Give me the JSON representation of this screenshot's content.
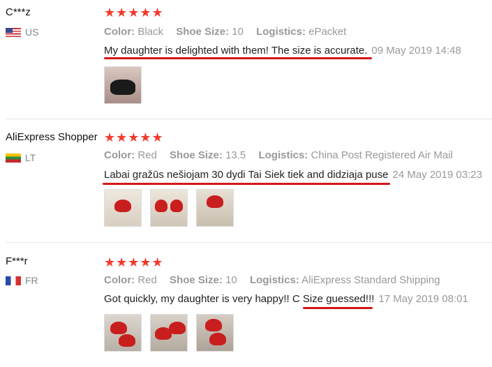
{
  "reviews": [
    {
      "user": "C***z",
      "country": "US",
      "rating_stars": 5,
      "stars_text": "★★★★★",
      "attributes": [
        {
          "label": "Color:",
          "value": "Black"
        },
        {
          "label": "Shoe Size:",
          "value": "10"
        },
        {
          "label": "Logistics:",
          "value": "ePacket"
        }
      ],
      "comment": "My daughter is delighted with them! The size is accurate.",
      "date": "09 May 2019 14:48"
    },
    {
      "user": "AliExpress Shopper",
      "country": "LT",
      "rating_stars": 5,
      "stars_text": "★★★★★",
      "attributes": [
        {
          "label": "Color:",
          "value": "Red"
        },
        {
          "label": "Shoe Size:",
          "value": "13.5"
        },
        {
          "label": "Logistics:",
          "value": "China Post Registered Air Mail"
        }
      ],
      "comment": "Labai gražūs nešiojam 30 dydi Tai Siek tiek and didziaja puse",
      "date": "24 May 2019 03:23"
    },
    {
      "user": "F***r",
      "country": "FR",
      "rating_stars": 5,
      "stars_text": "★★★★★",
      "attributes": [
        {
          "label": "Color:",
          "value": "Red"
        },
        {
          "label": "Shoe Size:",
          "value": "10"
        },
        {
          "label": "Logistics:",
          "value": "AliExpress Standard Shipping"
        }
      ],
      "comment_part1": "Got quickly, my daughter is very happy!! C ",
      "comment_part2": "Size guessed!!!",
      "date": "17 May 2019 08:01"
    }
  ],
  "colors": {
    "star": "#f23a2e",
    "annotation_underline": "#d31616",
    "muted_text": "#999999"
  }
}
